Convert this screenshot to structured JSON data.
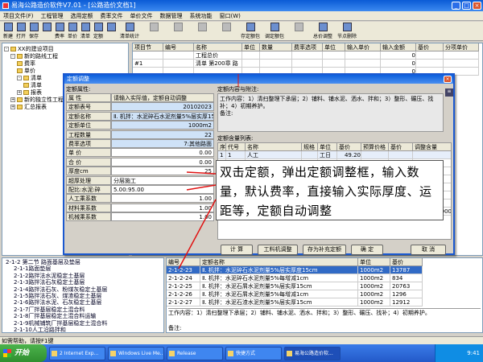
{
  "window": {
    "title": "易海公路造价软件V7.01 - [公路造价文档1]"
  },
  "menu": [
    "项目文件(F)",
    "工程管理",
    "选用定额",
    "费率文件",
    "单价文件",
    "数据管理",
    "系统功能",
    "窗口(W)"
  ],
  "toolbar": {
    "buttons": [
      {
        "label": "新建",
        "dim": false
      },
      {
        "label": "打开",
        "dim": false
      },
      {
        "label": "保存",
        "dim": false
      },
      {
        "label": "",
        "dim": false
      },
      {
        "label": "费率",
        "dim": false
      },
      {
        "label": "单价",
        "dim": false
      },
      {
        "label": "清单",
        "dim": false
      },
      {
        "label": "定额",
        "dim": false
      },
      {
        "label": "",
        "dim": false
      }
    ],
    "wide_buttons": [
      {
        "label": "清单统计",
        "dim": false
      },
      {
        "label": "",
        "dim": true
      },
      {
        "label": "",
        "dim": true
      },
      {
        "label": "",
        "dim": true
      },
      {
        "label": "",
        "dim": true
      },
      {
        "label": "存定额包",
        "dim": false
      },
      {
        "label": "调定额包",
        "dim": false
      },
      {
        "label": "",
        "dim": true
      },
      {
        "label": "总价调整",
        "dim": false
      },
      {
        "label": "节点删除",
        "dim": false
      }
    ]
  },
  "tree": {
    "items": [
      {
        "label": "XX的建设项目",
        "depth": 0,
        "expander": "-"
      },
      {
        "label": "新的路线工程",
        "depth": 1,
        "expander": "-"
      },
      {
        "label": "费率",
        "depth": 2,
        "expander": ""
      },
      {
        "label": "单价",
        "depth": 2,
        "expander": ""
      },
      {
        "label": "清单",
        "depth": 2,
        "expander": "-"
      },
      {
        "label": "清单",
        "depth": 3,
        "expander": ""
      },
      {
        "label": "报表",
        "depth": 2,
        "expander": "+"
      },
      {
        "label": "新的独立性工程",
        "depth": 1,
        "expander": "+"
      },
      {
        "label": "汇总报表",
        "depth": 1,
        "expander": "+"
      }
    ]
  },
  "grid": {
    "headers": [
      "项目节",
      "编号",
      "名称",
      "单位",
      "数量",
      "费率选项",
      "单位",
      "输入单价",
      "输入金额",
      "基价",
      "分项单价"
    ],
    "rows": [
      [
        "",
        "",
        "工程总价",
        "",
        "",
        "",
        "",
        "",
        "0",
        "",
        ""
      ],
      [
        "#1",
        "",
        "清单  第200章  路",
        "",
        "",
        "",
        "",
        "",
        "0",
        "",
        ""
      ],
      [
        "",
        "",
        "",
        "",
        "",
        "",
        "",
        "",
        "0",
        "",
        ""
      ]
    ]
  },
  "dialog": {
    "title": "定额调整",
    "left_caption": "定额属性:",
    "prop_header": [
      "属 性",
      "请输入实际值，定额自动调整"
    ],
    "props": [
      [
        "定额表号",
        "20102023",
        "right",
        "blue"
      ],
      [
        "定额名称",
        "Ⅱ. 机拌：水泥碎石水泥剂量5%层实厚15",
        "left",
        "blue"
      ],
      [
        "定额单位",
        "1000m2",
        "right",
        "blue"
      ],
      [
        "工程数量",
        "22",
        "right",
        "blue"
      ],
      [
        "费率选项",
        "7:其他路面",
        "right",
        "blue"
      ],
      [
        "单  价",
        "0.00",
        "right",
        "white"
      ],
      [
        "合  价",
        "0.00",
        "right",
        "white"
      ],
      [
        "厚度cm",
        "25",
        "right",
        "white"
      ],
      [
        "超厚处理",
        "分层施工",
        "left",
        "white"
      ],
      [
        "配比:水泥:碎",
        "5.00:95.00",
        "left",
        "white"
      ],
      [
        "人工乘系数",
        "1.00",
        "right",
        "white"
      ],
      [
        "材料乘系数",
        "1.00",
        "right",
        "white"
      ],
      [
        "机械乘系数",
        "1.00",
        "right",
        "white"
      ]
    ],
    "content_caption": "定额内容与附注:",
    "content_text": "工作内容：1）清扫整理下承层；2）铺料、铺水泥、洒水、拌和；3）整形、碾压、找补；4）初期养护。",
    "remark": "备注:",
    "rm_caption": "定额含量列表:",
    "rm_headers": [
      "序",
      "代号",
      "名称",
      "规格",
      "单位",
      "基价",
      "预算价格",
      "基价",
      "调整含量"
    ],
    "rm_rows": [
      [
        "1",
        "1",
        "人工",
        "",
        "工日",
        "49.20",
        "",
        "",
        ""
      ],
      [
        "",
        "",
        "",
        "",
        "",
        "",
        "",
        "",
        ""
      ],
      [
        "",
        "",
        "",
        "",
        "",
        "",
        "",
        "",
        ""
      ],
      [
        "",
        "",
        "",
        "",
        "",
        "",
        "",
        "",
        ""
      ],
      [
        "",
        "",
        "",
        "",
        "",
        "",
        "",
        "",
        ""
      ],
      [
        "",
        "",
        "",
        "",
        "",
        "",
        "",
        "",
        ""
      ],
      [
        "",
        "",
        "",
        "",
        "",
        "",
        "",
        "",
        ""
      ],
      [
        "9",
        "1999",
        "基价",
        "",
        "元",
        "1.00",
        "3787.000",
        "1.00",
        "3787.000"
      ]
    ],
    "buttons": [
      "计 算",
      "工料机调整",
      "存为补充定额",
      "确 定",
      "取 消"
    ]
  },
  "overlay_text": "双击定额，弹出定额调整框，输入数量，默认费率，直接输入实际厚度、运距等，定额自动调整",
  "bottom": {
    "list_items": [
      "2-1-2 第二节 路面基层及垫层",
      "2-1-1路面垫层",
      "2-1-2路拌法水泥稳定土基层",
      "2-1-3路拌法石灰稳定土基层",
      "2-1-4路拌法石灰、粉煤灰稳定土基层",
      "2-1-5路拌法石灰、煤渣稳定土基层",
      "2-1-6路拌法水泥、石灰稳定土基层",
      "2-1-7厂拌基层稳定土混合料",
      "2-1-8厂拌基层稳定土混合料运输",
      "2-1-9机械铺筑厂拌基层稳定土混合料",
      "2-1-10人工沿路拌和"
    ],
    "table_headers": [
      "编号",
      "定额名称",
      "单位",
      "基价"
    ],
    "table_rows": [
      [
        "2-1-2-23",
        "Ⅱ. 机拌：水泥碎石水泥剂量5%层实厚度15cm",
        "1000m2",
        "13787"
      ],
      [
        "2-1-2-24",
        "Ⅱ. 机拌：水泥碎石水泥剂量5%每增减1cm",
        "1000m2",
        "834"
      ],
      [
        "2-1-2-25",
        "Ⅱ. 机拌：水泥石屑水泥剂量5%层实厚15cm",
        "1000m2",
        "20763"
      ],
      [
        "2-1-2-26",
        "Ⅱ. 机拌：水泥石屑水泥剂量5%每增减1cm",
        "1000m2",
        "1296"
      ],
      [
        "2-1-2-27",
        "Ⅱ. 机拌：水泥石渣水泥剂量5%层实厚15cm",
        "1000m2",
        "12912"
      ]
    ],
    "work_text": "工作内容：1）清扫整理下承层；2）铺料、铺水泥、洒水、拌和；3）整形、碾压、找补；4）初期养护。",
    "remark": "备注:"
  },
  "status": "如需帮助，请按F1键",
  "taskbar": {
    "start": "开始",
    "tasks": [
      "2 Internet Exp...",
      "Windows Live Me...",
      "Release",
      "快捷方式",
      "易海公路造价软..."
    ],
    "clock": "9:41"
  }
}
